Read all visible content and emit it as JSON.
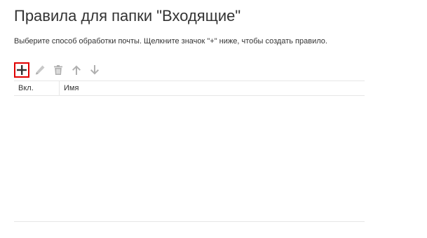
{
  "page": {
    "title": "Правила для папки \"Входящие\"",
    "instructions": "Выберите способ обработки почты. Щелкните значок \"+\" ниже, чтобы создать правило."
  },
  "toolbar": {
    "add": {
      "icon": "plus-icon",
      "highlighted": true,
      "highlight_color": "#e00000"
    },
    "edit": {
      "icon": "pencil-icon"
    },
    "delete": {
      "icon": "trash-icon"
    },
    "move_up": {
      "icon": "arrow-up-icon"
    },
    "move_down": {
      "icon": "arrow-down-icon"
    }
  },
  "rules_table": {
    "columns": [
      "Вкл.",
      "Имя"
    ],
    "rows": []
  }
}
